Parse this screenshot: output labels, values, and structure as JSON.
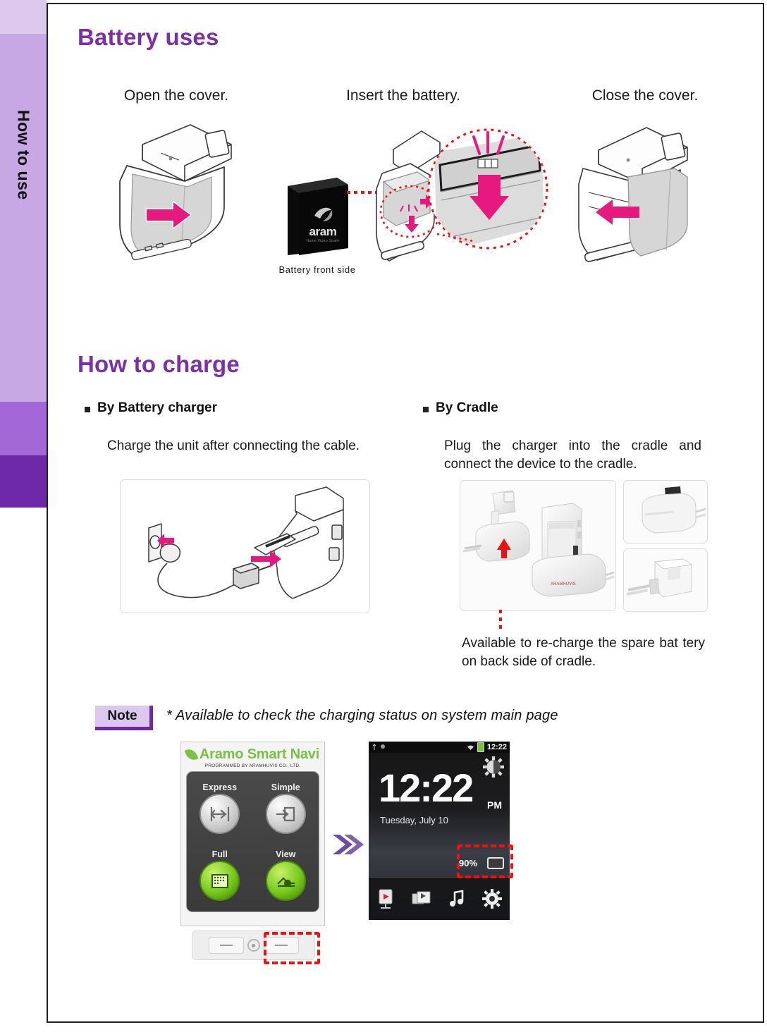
{
  "sidebar": {
    "tab_label": "How to use",
    "colors": {
      "light": "#ddc9ee",
      "main": "#c8a7e5",
      "mid": "#a368d6",
      "deep": "#6d28a8"
    }
  },
  "headings": {
    "battery_uses": "Battery uses",
    "how_to_charge": "How to charge"
  },
  "battery_steps": [
    {
      "caption": "Open the cover."
    },
    {
      "caption": "Insert the battery.",
      "sub_caption": "Battery front side",
      "battery_brand": "aram",
      "battery_brand_sub": "Home Video Spare"
    },
    {
      "caption": "Close the cover."
    }
  ],
  "charge": {
    "left": {
      "bullet": "By Battery charger",
      "text": "Charge the unit after connecting the cable."
    },
    "right": {
      "bullet": "By Cradle",
      "text": "Plug the charger into the cradle and connect the device to the cradle.",
      "footnote": "Available to re-charge the spare bat tery on back side of cradle."
    }
  },
  "note": {
    "badge": "Note",
    "text": "* Available to check the charging status on system main page"
  },
  "app_screen": {
    "title": "Aramo Smart Navi",
    "subtitle": "PROGRAMMED BY ARAMHUVIS CO., LTD.",
    "buttons": [
      {
        "label": "Express",
        "style": "grey"
      },
      {
        "label": "Simple",
        "style": "grey"
      },
      {
        "label": "Full",
        "style": "green"
      },
      {
        "label": "View",
        "style": "green"
      }
    ]
  },
  "android_screen": {
    "status_time": "12:22",
    "clock": "12:22",
    "clock_meridiem": "PM",
    "date": "Tuesday, July 10",
    "battery_percent": "90%",
    "dock_icons": [
      "video-icon",
      "gallery-icon",
      "music-icon",
      "settings-icon"
    ]
  },
  "colors": {
    "heading_purple": "#7b2fa8",
    "arrow_pink": "#e6197f",
    "highlight_red": "#ee1111",
    "app_green": "#7ac143"
  }
}
